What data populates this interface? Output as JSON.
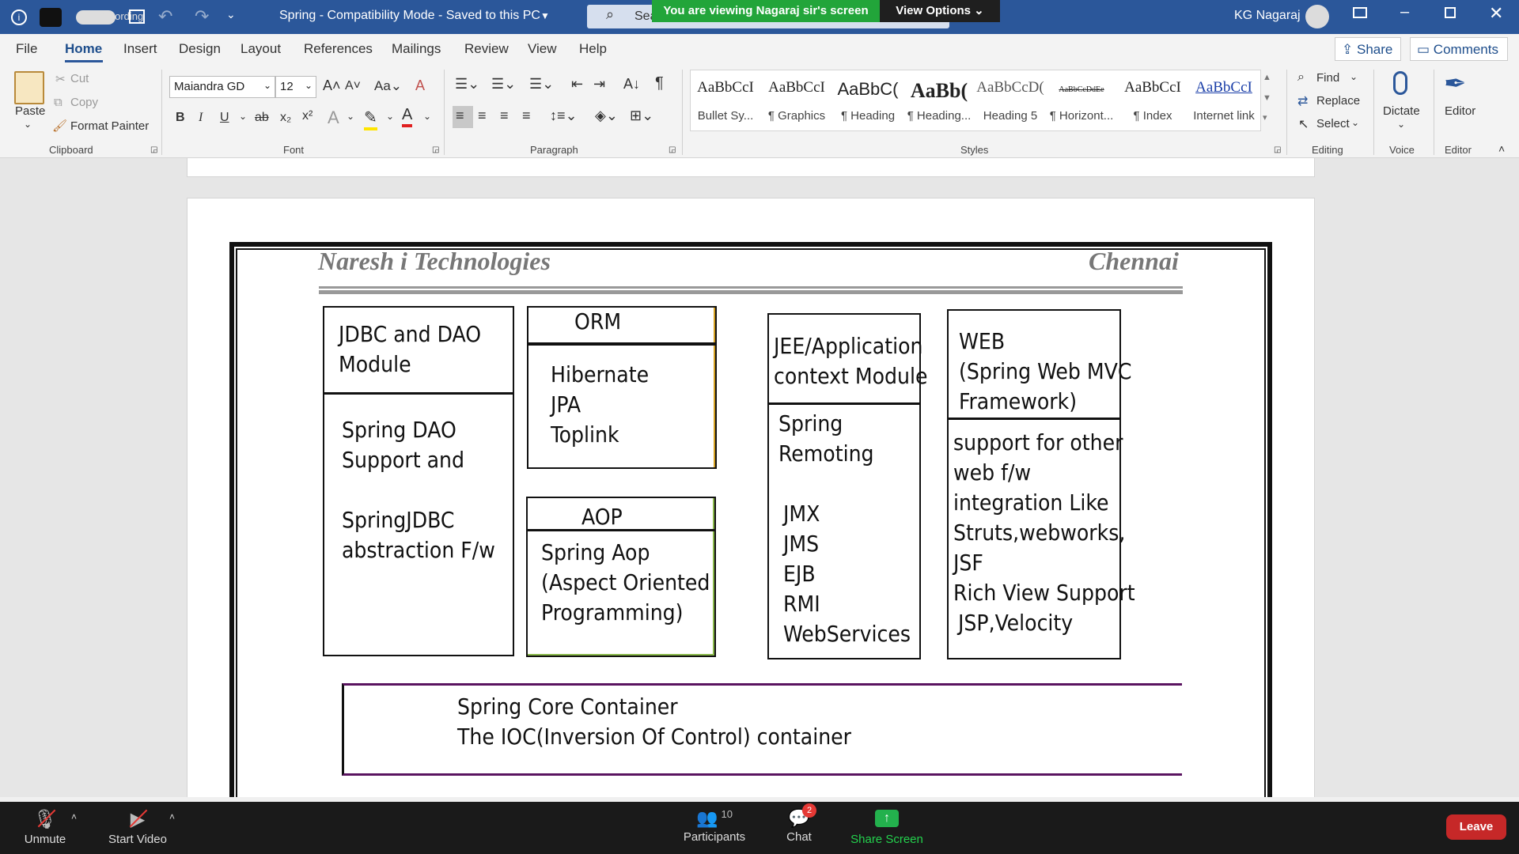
{
  "title_bar": {
    "record_label": "Recording",
    "doc_title": "Spring  -  Compatibility Mode  -  Saved to this PC",
    "search_placeholder": "Search",
    "user": "KG Nagaraj"
  },
  "zoom_banner": {
    "text": "You are viewing Nagaraj sir's screen",
    "view_options": "View Options"
  },
  "menu": [
    "File",
    "Home",
    "Insert",
    "Design",
    "Layout",
    "References",
    "Mailings",
    "Review",
    "View",
    "Help"
  ],
  "share_label": "Share",
  "comments_label": "Comments",
  "ribbon": {
    "clipboard": {
      "paste": "Paste",
      "cut": "Cut",
      "copy": "Copy",
      "format_painter": "Format Painter",
      "group": "Clipboard"
    },
    "font": {
      "name": "Maiandra GD",
      "size": "12",
      "group": "Font"
    },
    "paragraph": {
      "group": "Paragraph"
    },
    "styles": {
      "group": "Styles",
      "items": [
        {
          "preview": "AaBbCcI",
          "name": "Bullet Sy..."
        },
        {
          "preview": "AaBbCcI",
          "name": "¶ Graphics"
        },
        {
          "preview": "AaBbC(",
          "name": "¶ Heading"
        },
        {
          "preview": "AaBb(",
          "name": "¶ Heading..."
        },
        {
          "preview": "AaBbCcD(",
          "name": "Heading 5"
        },
        {
          "preview": "AaBbCcDdEe",
          "name": "¶ Horizont..."
        },
        {
          "preview": "AaBbCcI",
          "name": "¶ Index"
        },
        {
          "preview": "AaBbCcI",
          "name": "Internet link"
        }
      ]
    },
    "editing": {
      "find": "Find",
      "replace": "Replace",
      "select": "Select",
      "group": "Editing"
    },
    "voice": {
      "dictate": "Dictate",
      "group": "Voice"
    },
    "editor": {
      "label": "Editor",
      "group": "Editor"
    }
  },
  "document": {
    "header_left": "Naresh i Technologies",
    "header_right": "Chennai",
    "jdbc": {
      "title": [
        "JDBC and DAO",
        "Module"
      ],
      "body": [
        "Spring DAO",
        "Support and",
        "",
        "SpringJDBC",
        "abstraction F/w"
      ]
    },
    "orm": {
      "title": "ORM",
      "body": [
        "Hibernate",
        "JPA",
        "Toplink"
      ]
    },
    "aop": {
      "title": "AOP",
      "body": [
        "Spring Aop",
        "(Aspect Oriented",
        "Programming)"
      ]
    },
    "jee": {
      "title": [
        "JEE/Application",
        "context Module"
      ],
      "body": [
        "Spring",
        "Remoting",
        "",
        "JMX",
        "JMS",
        "EJB",
        "RMI",
        "WebServices"
      ]
    },
    "web": {
      "title": [
        "WEB",
        "(Spring Web MVC",
        "Framework)"
      ],
      "body": [
        "support for other",
        "web f/w",
        "integration Like",
        "Struts,webworks,",
        "JSF",
        "Rich View Support",
        " JSP,Velocity"
      ]
    },
    "core": [
      "Spring Core Container",
      "The IOC(Inversion Of  Control) container"
    ]
  },
  "zoom_bar": {
    "unmute": "Unmute",
    "start_video": "Start Video",
    "participants": "Participants",
    "participant_count": "10",
    "chat": "Chat",
    "chat_badge": "2",
    "share_screen": "Share Screen",
    "leave": "Leave"
  }
}
